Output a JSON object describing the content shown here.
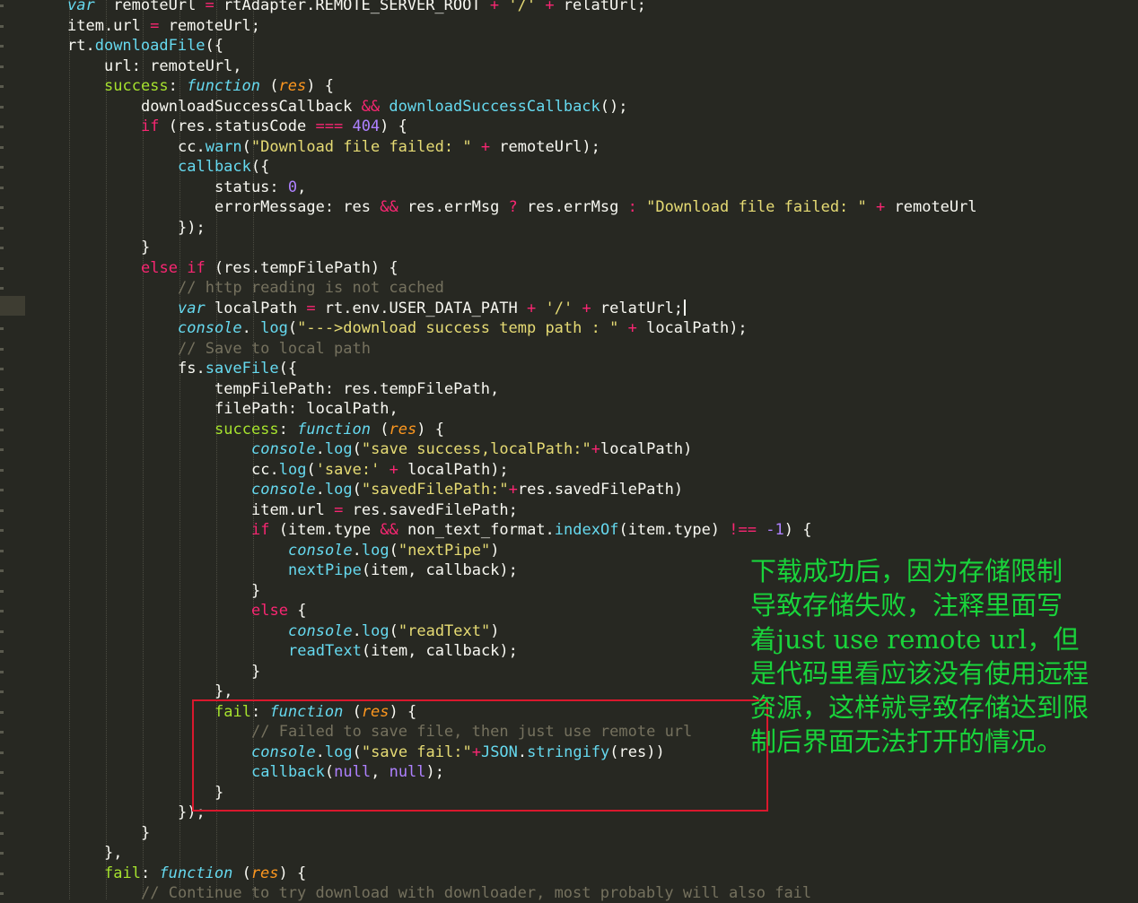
{
  "editor": {
    "theme_colors": {
      "background": "#272822",
      "keyword": "#f92672",
      "function": "#66d9ef",
      "string": "#e6db74",
      "number": "#ae81ff",
      "comment": "#75715e",
      "property": "#a6e22e",
      "parameter": "#fd971f",
      "text": "#f8f8f2"
    },
    "cursor_line": 15,
    "lines": [
      {
        "indent": 1,
        "tokens": [
          [
            "kwi",
            "var"
          ],
          [
            "",
            "  remoteUrl "
          ],
          [
            "op",
            "="
          ],
          [
            "",
            " rtAdapter.REMOTE_SERVER_ROOT "
          ],
          [
            "op",
            "+"
          ],
          [
            "",
            " "
          ],
          [
            "str",
            "'/'"
          ],
          [
            "",
            " "
          ],
          [
            "op",
            "+"
          ],
          [
            "",
            " relatUrl;"
          ]
        ]
      },
      {
        "indent": 1,
        "tokens": [
          [
            "",
            "item.url "
          ],
          [
            "op",
            "="
          ],
          [
            "",
            " remoteUrl;"
          ]
        ]
      },
      {
        "indent": 1,
        "tokens": [
          [
            "",
            "rt."
          ],
          [
            "fn",
            "downloadFile"
          ],
          [
            "",
            "({"
          ]
        ]
      },
      {
        "indent": 2,
        "tokens": [
          [
            "",
            "url: remoteUrl,"
          ]
        ]
      },
      {
        "indent": 2,
        "tokens": [
          [
            "prop",
            "success"
          ],
          [
            "",
            ": "
          ],
          [
            "kwi",
            "function"
          ],
          [
            "",
            " ("
          ],
          [
            "param",
            "res"
          ],
          [
            "",
            ") {"
          ]
        ]
      },
      {
        "indent": 3,
        "tokens": [
          [
            "",
            "downloadSuccessCallback "
          ],
          [
            "op",
            "&&"
          ],
          [
            "",
            " "
          ],
          [
            "fn",
            "downloadSuccessCallback"
          ],
          [
            "",
            "();"
          ]
        ]
      },
      {
        "indent": 3,
        "tokens": [
          [
            "kw",
            "if"
          ],
          [
            "",
            " (res.statusCode "
          ],
          [
            "op",
            "==="
          ],
          [
            "",
            " "
          ],
          [
            "num",
            "404"
          ],
          [
            "",
            ") {"
          ]
        ]
      },
      {
        "indent": 4,
        "tokens": [
          [
            "",
            "cc."
          ],
          [
            "fn",
            "warn"
          ],
          [
            "",
            "("
          ],
          [
            "str",
            "\"Download file failed: \""
          ],
          [
            "",
            " "
          ],
          [
            "op",
            "+"
          ],
          [
            "",
            " remoteUrl);"
          ]
        ]
      },
      {
        "indent": 4,
        "tokens": [
          [
            "fn",
            "callback"
          ],
          [
            "",
            "({"
          ]
        ]
      },
      {
        "indent": 5,
        "tokens": [
          [
            "",
            "status: "
          ],
          [
            "num",
            "0"
          ],
          [
            "",
            ","
          ]
        ]
      },
      {
        "indent": 5,
        "tokens": [
          [
            "",
            "errorMessage: res "
          ],
          [
            "op",
            "&&"
          ],
          [
            "",
            " res.errMsg "
          ],
          [
            "op",
            "?"
          ],
          [
            "",
            " res.errMsg "
          ],
          [
            "op",
            ":"
          ],
          [
            "",
            " "
          ],
          [
            "str",
            "\"Download file failed: \""
          ],
          [
            "",
            " "
          ],
          [
            "op",
            "+"
          ],
          [
            "",
            " remoteUrl"
          ]
        ]
      },
      {
        "indent": 4,
        "tokens": [
          [
            "",
            "});"
          ]
        ]
      },
      {
        "indent": 3,
        "tokens": [
          [
            "",
            "}"
          ]
        ]
      },
      {
        "indent": 3,
        "tokens": [
          [
            "kw",
            "else"
          ],
          [
            "",
            " "
          ],
          [
            "kw",
            "if"
          ],
          [
            "",
            " (res.tempFilePath) {"
          ]
        ]
      },
      {
        "indent": 4,
        "tokens": [
          [
            "cmt",
            "// http reading is not cached"
          ]
        ]
      },
      {
        "indent": 4,
        "tokens": [
          [
            "kwi",
            "var"
          ],
          [
            "",
            " localPath "
          ],
          [
            "op",
            "="
          ],
          [
            "",
            " rt.env.USER_DATA_PATH "
          ],
          [
            "op",
            "+"
          ],
          [
            "",
            " "
          ],
          [
            "str",
            "'/'"
          ],
          [
            "",
            " "
          ],
          [
            "op",
            "+"
          ],
          [
            "",
            " relatUrl;"
          ]
        ]
      },
      {
        "indent": 4,
        "tokens": [
          [
            "kwi",
            "console"
          ],
          [
            "",
            ". "
          ],
          [
            "fn",
            "log"
          ],
          [
            "",
            "("
          ],
          [
            "str",
            "\"--->download success temp path : \""
          ],
          [
            "",
            " "
          ],
          [
            "op",
            "+"
          ],
          [
            "",
            " localPath);"
          ]
        ]
      },
      {
        "indent": 4,
        "tokens": [
          [
            "cmt",
            "// Save to local path"
          ]
        ]
      },
      {
        "indent": 4,
        "tokens": [
          [
            "",
            "fs."
          ],
          [
            "fn",
            "saveFile"
          ],
          [
            "",
            "({"
          ]
        ]
      },
      {
        "indent": 5,
        "tokens": [
          [
            "",
            "tempFilePath: res.tempFilePath,"
          ]
        ]
      },
      {
        "indent": 5,
        "tokens": [
          [
            "",
            "filePath: localPath,"
          ]
        ]
      },
      {
        "indent": 5,
        "tokens": [
          [
            "prop",
            "success"
          ],
          [
            "",
            ": "
          ],
          [
            "kwi",
            "function"
          ],
          [
            "",
            " ("
          ],
          [
            "param",
            "res"
          ],
          [
            "",
            ") {"
          ]
        ]
      },
      {
        "indent": 6,
        "tokens": [
          [
            "kwi",
            "console"
          ],
          [
            "",
            "."
          ],
          [
            "fn",
            "log"
          ],
          [
            "",
            "("
          ],
          [
            "str",
            "\"save success,localPath:\""
          ],
          [
            "op",
            "+"
          ],
          [
            "",
            "localPath)"
          ]
        ]
      },
      {
        "indent": 6,
        "tokens": [
          [
            "",
            "cc."
          ],
          [
            "fn",
            "log"
          ],
          [
            "",
            "("
          ],
          [
            "str",
            "'save:'"
          ],
          [
            "",
            " "
          ],
          [
            "op",
            "+"
          ],
          [
            "",
            " localPath);"
          ]
        ]
      },
      {
        "indent": 6,
        "tokens": [
          [
            "kwi",
            "console"
          ],
          [
            "",
            "."
          ],
          [
            "fn",
            "log"
          ],
          [
            "",
            "("
          ],
          [
            "str",
            "\"savedFilePath:\""
          ],
          [
            "op",
            "+"
          ],
          [
            "",
            "res.savedFilePath)"
          ]
        ]
      },
      {
        "indent": 6,
        "tokens": [
          [
            "",
            "item.url "
          ],
          [
            "op",
            "="
          ],
          [
            "",
            " res.savedFilePath;"
          ]
        ]
      },
      {
        "indent": 6,
        "tokens": [
          [
            "kw",
            "if"
          ],
          [
            "",
            " (item.type "
          ],
          [
            "op",
            "&&"
          ],
          [
            "",
            " non_text_format."
          ],
          [
            "fn",
            "indexOf"
          ],
          [
            "",
            "(item.type) "
          ],
          [
            "op",
            "!=="
          ],
          [
            "",
            " "
          ],
          [
            "num",
            "-1"
          ],
          [
            "",
            ") {"
          ]
        ]
      },
      {
        "indent": 7,
        "tokens": [
          [
            "kwi",
            "console"
          ],
          [
            "",
            "."
          ],
          [
            "fn",
            "log"
          ],
          [
            "",
            "("
          ],
          [
            "str",
            "\"nextPipe\""
          ],
          [
            "",
            ")"
          ]
        ]
      },
      {
        "indent": 7,
        "tokens": [
          [
            "fn",
            "nextPipe"
          ],
          [
            "",
            "(item, callback);"
          ]
        ]
      },
      {
        "indent": 6,
        "tokens": [
          [
            "",
            "}"
          ]
        ]
      },
      {
        "indent": 6,
        "tokens": [
          [
            "kw",
            "else"
          ],
          [
            "",
            " {"
          ]
        ]
      },
      {
        "indent": 7,
        "tokens": [
          [
            "kwi",
            "console"
          ],
          [
            "",
            "."
          ],
          [
            "fn",
            "log"
          ],
          [
            "",
            "("
          ],
          [
            "str",
            "\"readText\""
          ],
          [
            "",
            ")"
          ]
        ]
      },
      {
        "indent": 7,
        "tokens": [
          [
            "fn",
            "readText"
          ],
          [
            "",
            "(item, callback);"
          ]
        ]
      },
      {
        "indent": 6,
        "tokens": [
          [
            "",
            "}"
          ]
        ]
      },
      {
        "indent": 5,
        "tokens": [
          [
            "",
            "},"
          ]
        ]
      },
      {
        "indent": 5,
        "tokens": [
          [
            "prop",
            "fail"
          ],
          [
            "",
            ": "
          ],
          [
            "kwi",
            "function"
          ],
          [
            "",
            " ("
          ],
          [
            "param",
            "res"
          ],
          [
            "",
            ") {"
          ]
        ]
      },
      {
        "indent": 6,
        "tokens": [
          [
            "cmt",
            "// Failed to save file, then just use remote url"
          ]
        ]
      },
      {
        "indent": 6,
        "tokens": [
          [
            "kwi",
            "console"
          ],
          [
            "",
            "."
          ],
          [
            "fn",
            "log"
          ],
          [
            "",
            "("
          ],
          [
            "str",
            "\"save fail:\""
          ],
          [
            "op",
            "+"
          ],
          [
            "fn",
            "JSON"
          ],
          [
            "",
            "."
          ],
          [
            "fn",
            "stringify"
          ],
          [
            "",
            "(res))"
          ]
        ]
      },
      {
        "indent": 6,
        "tokens": [
          [
            "fn",
            "callback"
          ],
          [
            "",
            "("
          ],
          [
            "num",
            "null"
          ],
          [
            "",
            ", "
          ],
          [
            "num",
            "null"
          ],
          [
            "",
            ");"
          ]
        ]
      },
      {
        "indent": 5,
        "tokens": [
          [
            "",
            "}"
          ]
        ]
      },
      {
        "indent": 4,
        "tokens": [
          [
            "",
            "});"
          ]
        ]
      },
      {
        "indent": 3,
        "tokens": [
          [
            "",
            "}"
          ]
        ]
      },
      {
        "indent": 2,
        "tokens": [
          [
            "",
            "},"
          ]
        ]
      },
      {
        "indent": 2,
        "tokens": [
          [
            "prop",
            "fail"
          ],
          [
            "",
            ": "
          ],
          [
            "kwi",
            "function"
          ],
          [
            "",
            " ("
          ],
          [
            "param",
            "res"
          ],
          [
            "",
            ") {"
          ]
        ]
      },
      {
        "indent": 3,
        "tokens": [
          [
            "cmt",
            "// Continue to try download with downloader, most probably will also fail"
          ]
        ]
      }
    ]
  },
  "annotation": {
    "color": "#19d43b",
    "lines": [
      "下载成功后，因为存储限制",
      "导致存储失败，注释里面写",
      "着just use remote url，但",
      "是代码里看应该没有使用远程",
      "资源，这样就导致存储达到限",
      "制后界面无法打开的情况。"
    ]
  }
}
